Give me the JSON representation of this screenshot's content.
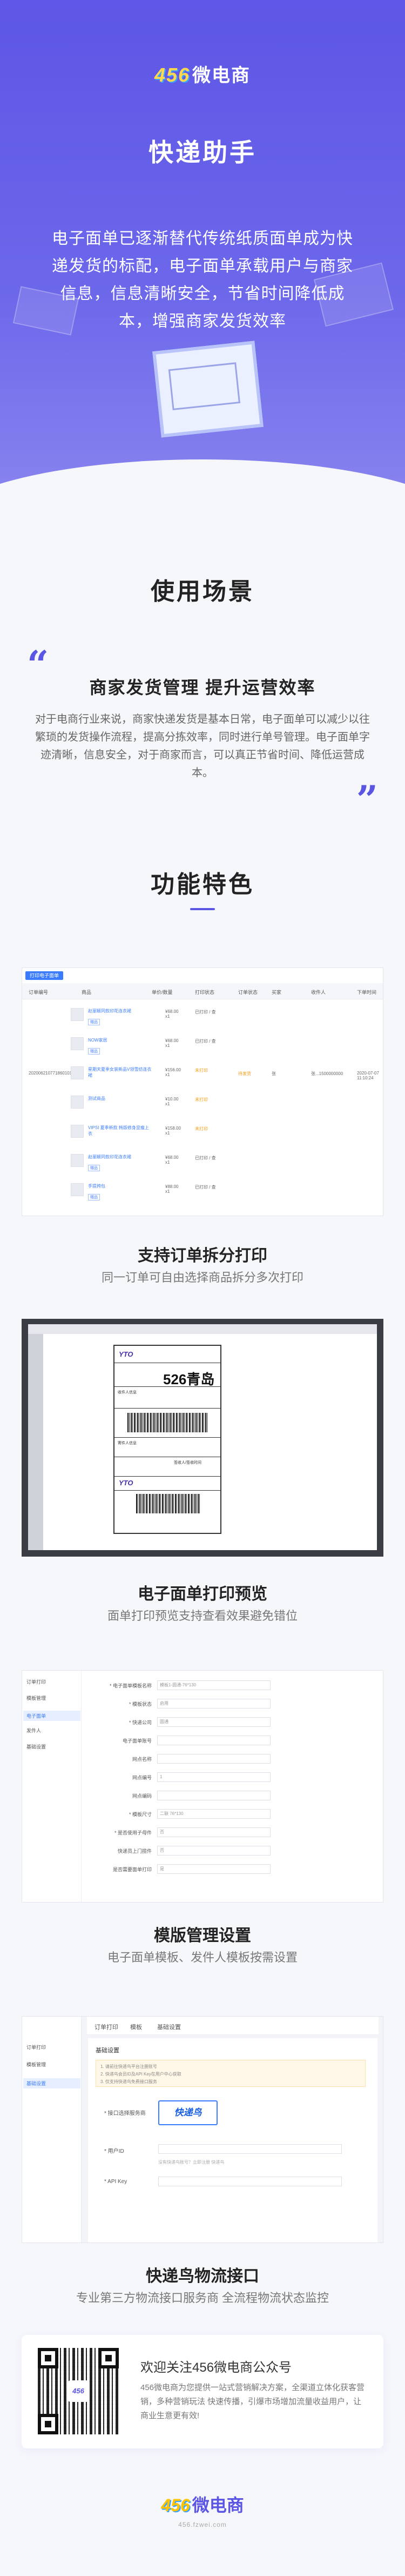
{
  "brand": {
    "badge": "456",
    "name": "微电商"
  },
  "hero": {
    "title": "快递助手",
    "text": "电子面单已逐渐替代传统纸质面单成为快递发货的标配，电子面单承载用户与商家信息，信息清晰安全，节省时间降低成本，增强商家发货效率"
  },
  "scenario": {
    "title": "使用场景",
    "subtitle": "商家发货管理 提升运营效率",
    "text": "对于电商行业来说，商家快递发货是基本日常，电子面单可以减少以往繁琐的发货操作流程，提高分拣效率，同时进行单号管理。电子面单字迹清晰，信息安全，对于商家而言，可以真正节省时间、降低运营成本。"
  },
  "features": {
    "title": "功能特色",
    "items": [
      {
        "title": "支持订单拆分打印",
        "desc": "同一订单可自由选择商品拆分多次打印"
      },
      {
        "title": "电子面单打印预览",
        "desc": "面单打印预览支持查看效果避免错位"
      },
      {
        "title": "模版管理设置",
        "desc": "电子面单模板、发件人模板按需设置"
      },
      {
        "title": "快递鸟物流接口",
        "desc": "专业第三方物流接口服务商  全流程物流状态监控"
      }
    ]
  },
  "screens": {
    "table": {
      "button": "打印电子面单",
      "headers": [
        "订单编号",
        "商品",
        "单价/数量",
        "打印状态",
        "订单状态",
        "买家",
        "收件人",
        "下单时间"
      ],
      "order_id": "2020062107718601018001",
      "status_label": "已打印",
      "order_status": "待发货",
      "buyer": "张",
      "receiver": "张...1500000000",
      "date": "2020-07-07 11:10:24",
      "rows": [
        {
          "name": "赵丽颖同款印花连衣裙",
          "tag": "赠品",
          "price": "¥68.00 x1",
          "status": "已打印 / 查"
        },
        {
          "name": "NOW家居",
          "tag": "赠品",
          "price": "¥68.00 x1",
          "status": "已打印 / 查"
        },
        {
          "name": "星期天夏季女装新品V领雪纺连衣裙",
          "tag": "",
          "price": "¥156.00 x1",
          "status": "未打印"
        },
        {
          "name": "测试商品",
          "tag": "",
          "price": "¥10.00 x1",
          "status": "未打印"
        },
        {
          "name": "VIPSI 夏季新款 韩版修身显瘦上衣",
          "tag": "",
          "price": "¥158.00 x1",
          "status": "未打印"
        },
        {
          "name": "赵丽颖同款印花连衣裙",
          "tag": "赠品",
          "price": "¥68.00 x1",
          "status": "已打印 / 查"
        },
        {
          "name": "手提挎包",
          "tag": "赠品",
          "price": "¥88.00 x1",
          "status": "已打印 / 查"
        }
      ]
    },
    "preview": {
      "brand": "YTO",
      "code": "526青岛",
      "small1": "收件人信息",
      "small2": "寄件人信息",
      "small3": "签收人/签收时间"
    },
    "template": {
      "sidebar": [
        "订单打印",
        "模板管理",
        "电子面单",
        "发件人",
        "基础设置"
      ],
      "fields": [
        {
          "label": "* 电子面单模板名称",
          "value": "模板1-圆通-76*130"
        },
        {
          "label": "* 模板状态",
          "value": "启用"
        },
        {
          "label": "* 快递公司",
          "value": "圆通"
        },
        {
          "label": "电子面单账号",
          "value": ""
        },
        {
          "label": "网点名称",
          "value": ""
        },
        {
          "label": "网点编号",
          "value": "1"
        },
        {
          "label": "网点编码",
          "value": ""
        },
        {
          "label": "* 模板尺寸",
          "value": "二联 76*130"
        },
        {
          "label": "* 是否使用子母件",
          "value": "否"
        },
        {
          "label": "快递员上门揽件",
          "value": "否"
        },
        {
          "label": "是否需要面单打印",
          "value": "是"
        }
      ]
    },
    "kuaidiniao": {
      "tabs": [
        "订单打印",
        "模板",
        "基础设置"
      ],
      "sidebar": [
        "订单打印",
        "模板管理",
        "基础设置"
      ],
      "section": "基础设置",
      "notes": [
        "1. 请前往快递鸟平台注册账号",
        "2. 快递鸟会员ID及API Key在用户中心获取",
        "3. 仅支持快递鸟免费接口服务"
      ],
      "select_label": "* 接口选择服务商",
      "brand": "快递鸟",
      "userid_label": "* 用户ID",
      "apikey_label": "* API Key",
      "hint": "没有快递鸟账号？立即注册 快递鸟"
    }
  },
  "footer": {
    "qr_title": "欢迎关注456微电商公众号",
    "qr_text": "456微电商为您提供一站式营销解决方案，全渠道立体化获客营销，多种营销玩法 快速传播，引爆市场增加流量收益用户，让商业生意更有效!",
    "url": "456.fzwei.com"
  }
}
